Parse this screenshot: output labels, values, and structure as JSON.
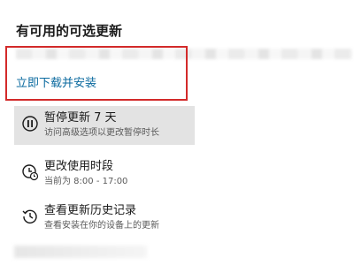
{
  "header": {
    "title": "有可用的可选更新"
  },
  "action": {
    "download_label": "立即下载并安装"
  },
  "options": [
    {
      "title": "暂停更新 7 天",
      "subtitle": "访问高级选项以更改暂停时长",
      "icon": "pause-icon"
    },
    {
      "title": "更改使用时段",
      "subtitle": "当前为 8:00 - 17:00",
      "icon": "clock-icon"
    },
    {
      "title": "查看更新历史记录",
      "subtitle": "查看安装在你的设备上的更新",
      "icon": "history-icon"
    }
  ],
  "colors": {
    "link": "#0b6a9f",
    "highlight_border": "#d32a2a",
    "selected_bg": "#e3e3e3"
  }
}
